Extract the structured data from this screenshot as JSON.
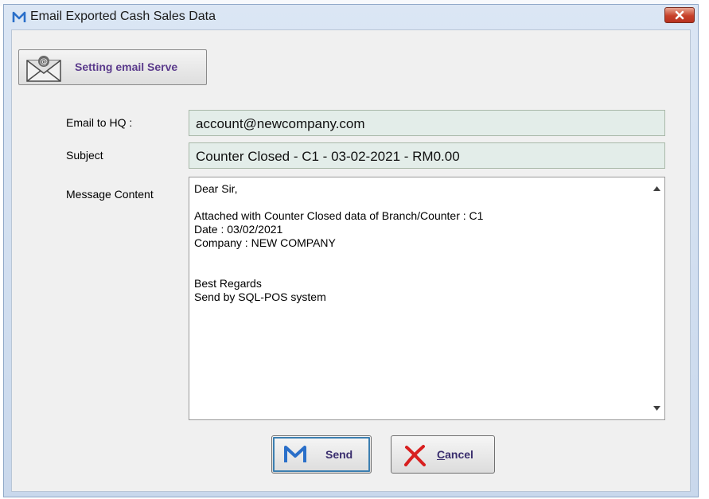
{
  "window": {
    "title": "Email Exported Cash Sales Data",
    "icon": "gmail-icon"
  },
  "toolbar": {
    "setting_email_label": "Setting email Serve",
    "setting_email_icon": "email-envelope-icon"
  },
  "form": {
    "email_label": "Email to HQ :",
    "email_value": "account@newcompany.com",
    "subject_label": "Subject",
    "subject_value": "Counter Closed - C1 -  03-02-2021 - RM0.00",
    "message_label": "Message Content",
    "message_lines": [
      "Dear Sir,",
      "",
      "Attached with Counter Closed data of Branch/Counter : C1",
      "Date : 03/02/2021",
      "Company : NEW COMPANY",
      "",
      "",
      "Best Regards",
      "Send by SQL-POS system"
    ]
  },
  "buttons": {
    "send_label": "Send",
    "cancel_first_letter": "C",
    "cancel_rest": "ancel"
  },
  "colors": {
    "field_background": "#e3ede9",
    "button_text": "#3a2e6e",
    "close_button": "#c7412a"
  }
}
